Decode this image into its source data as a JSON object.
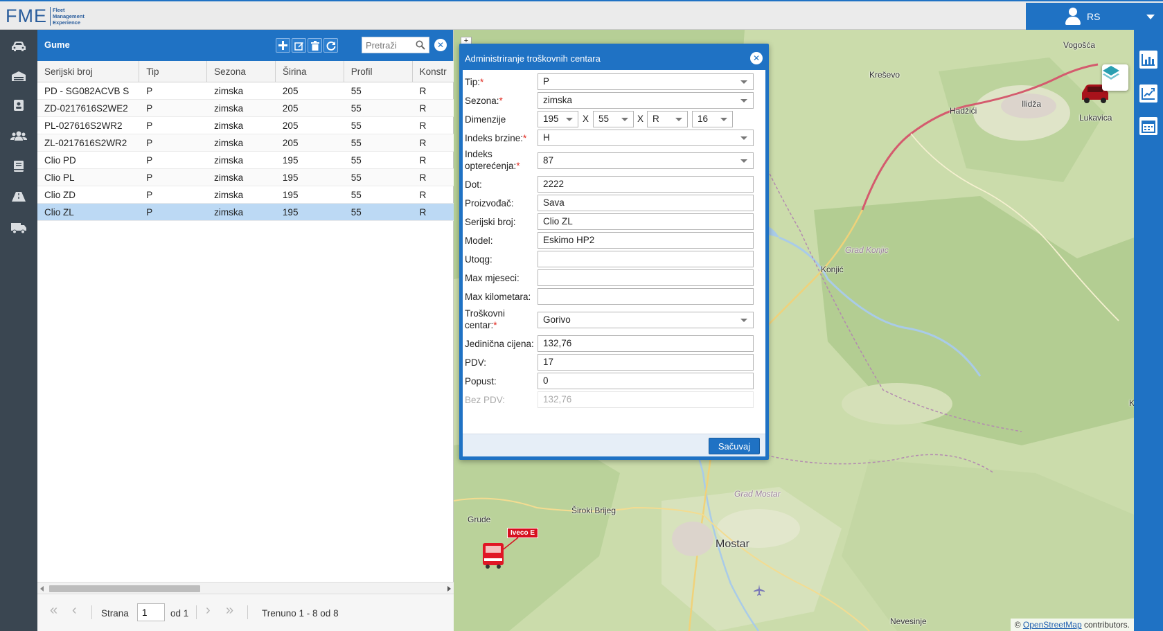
{
  "app": {
    "logo_main": "FME",
    "logo_sub": [
      "Fleet",
      "Management",
      "Experience"
    ],
    "user": "RS"
  },
  "panel": {
    "title": "Gume",
    "search_placeholder": "Pretraži",
    "columns": [
      "Serijski broj",
      "Tip",
      "Sezona",
      "Širina",
      "Profil",
      "Konstr"
    ],
    "rows": [
      [
        "PD - SG082ACVB S",
        "P",
        "zimska",
        "205",
        "55",
        "R"
      ],
      [
        "ZD-0217616S2WE2",
        "P",
        "zimska",
        "205",
        "55",
        "R"
      ],
      [
        "PL-027616S2WR2",
        "P",
        "zimska",
        "205",
        "55",
        "R"
      ],
      [
        "ZL-0217616S2WR2",
        "P",
        "zimska",
        "205",
        "55",
        "R"
      ],
      [
        "Clio PD",
        "P",
        "zimska",
        "195",
        "55",
        "R"
      ],
      [
        "Clio PL",
        "P",
        "zimska",
        "195",
        "55",
        "R"
      ],
      [
        "Clio ZD",
        "P",
        "zimska",
        "195",
        "55",
        "R"
      ],
      [
        "Clio ZL",
        "P",
        "zimska",
        "195",
        "55",
        "R"
      ]
    ],
    "selected_row": 7,
    "pager": {
      "page_label": "Strana",
      "page_value": "1",
      "of_label": "od 1",
      "status": "Trenuno 1 - 8 od 8"
    }
  },
  "dialog": {
    "title": "Administriranje troškovnih centara",
    "fields": {
      "tip": {
        "label": "Tip:",
        "value": "P"
      },
      "sezona": {
        "label": "Sezona:",
        "value": "zimska"
      },
      "dimenzije": {
        "label": "Dimenzije",
        "width": "195",
        "profile": "55",
        "construction": "R",
        "diameter": "16",
        "sep": "X"
      },
      "indeks_brzine": {
        "label": "Indeks brzine:",
        "value": "H"
      },
      "indeks_opterecenja": {
        "label1": "Indeks",
        "label2": "opterećenja:",
        "value": "87"
      },
      "dot": {
        "label": "Dot:",
        "value": "2222"
      },
      "proizvodac": {
        "label": "Proizvođač:",
        "value": "Sava"
      },
      "serijski_broj": {
        "label": "Serijski broj:",
        "value": "Clio ZL"
      },
      "model": {
        "label": "Model:",
        "value": "Eskimo HP2"
      },
      "utoqg": {
        "label": "Utoqg:",
        "value": ""
      },
      "max_mjeseci": {
        "label": "Max mjeseci:",
        "value": ""
      },
      "max_kilometara": {
        "label": "Max kilometara:",
        "value": ""
      },
      "troskovni_centar": {
        "label1": "Troškovni",
        "label2": "centar:",
        "value": "Gorivo"
      },
      "jedinicna_cijena": {
        "label": "Jedinična cijena:",
        "value": "132,76"
      },
      "pdv": {
        "label": "PDV:",
        "value": "17"
      },
      "popust": {
        "label": "Popust:",
        "value": "0"
      },
      "bez_pdv": {
        "label": "Bez PDV:",
        "value": "132,76"
      }
    },
    "required_mark": "*",
    "save_label": "Sačuvaj"
  },
  "map": {
    "labels": {
      "vogosca": "Vogošća",
      "kresevo": "Kreševo",
      "hadzici": "Hadžići",
      "ilidza": "Ilidža",
      "lukavica": "Lukavica",
      "grad_konjic": "Grad Konjic",
      "konjic": "Konjić",
      "grad_mostar": "Grad Mostar",
      "siroki": "Široki Brijeg",
      "grude": "Grude",
      "mostar": "Mostar",
      "nevesinje": "Nevesinje",
      "k": "K"
    },
    "vehicle_label": "Iveco E",
    "attribution_prefix": "©",
    "attribution_link": "OpenStreetMap",
    "attribution_suffix": "contributors.",
    "zoom_in": "+"
  },
  "colors": {
    "accent": "#1f72c4",
    "sidebar": "#3a4651",
    "selected_row": "#bcd9f4"
  }
}
